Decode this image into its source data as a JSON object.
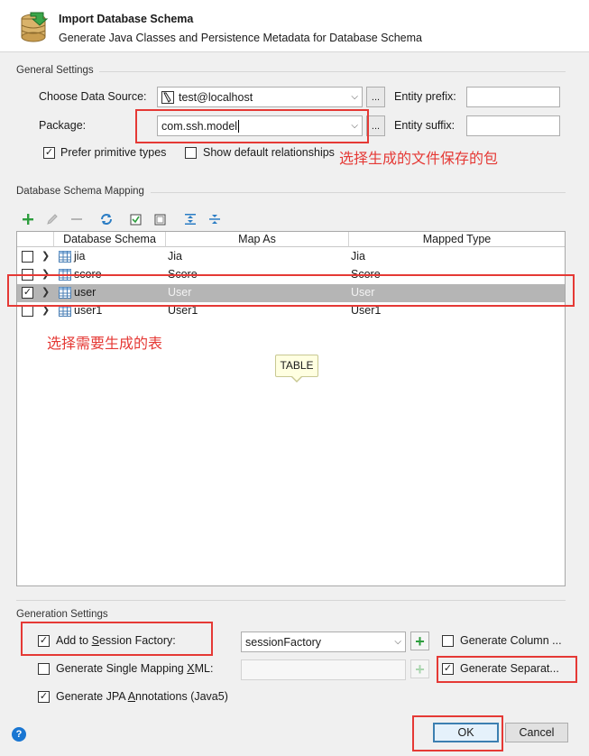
{
  "header": {
    "title": "Import Database Schema",
    "subtitle": "Generate Java Classes and Persistence Metadata for Database Schema"
  },
  "general": {
    "section_title": "General Settings",
    "datasource_label": "Choose Data Source:",
    "datasource_value": "test@localhost",
    "package_label": "Package:",
    "package_value": "com.ssh.model",
    "entity_prefix_label": "Entity prefix:",
    "entity_prefix_value": "",
    "entity_suffix_label": "Entity suffix:",
    "entity_suffix_value": "",
    "prefer_primitive_label": "Prefer primitive types",
    "prefer_primitive_checked": true,
    "show_relationships_label": "Show default relationships",
    "show_relationships_checked": false,
    "browse_label": "..."
  },
  "annotations": {
    "package_note": "选择生成的文件保存的包",
    "table_note": "选择需要生成的表"
  },
  "mapping": {
    "section_title": "Database Schema Mapping",
    "columns": [
      "Database Schema",
      "Map As",
      "Mapped Type"
    ],
    "rows": [
      {
        "checked": false,
        "schema": "jia",
        "map_as": "Jia",
        "mapped_type": "Jia",
        "selected": false
      },
      {
        "checked": false,
        "schema": "score",
        "map_as": "Score",
        "mapped_type": "Score",
        "selected": false
      },
      {
        "checked": true,
        "schema": "user",
        "map_as": "User",
        "mapped_type": "User",
        "selected": true
      },
      {
        "checked": false,
        "schema": "user1",
        "map_as": "User1",
        "mapped_type": "User1",
        "selected": false
      }
    ],
    "tooltip": "TABLE"
  },
  "generation": {
    "section_title": "Generation Settings",
    "add_session_factory_label": "Add to Session Factory:",
    "add_session_factory_checked": true,
    "session_factory_value": "sessionFactory",
    "generate_column_label": "Generate Column ...",
    "generate_column_checked": false,
    "single_mapping_label": "Generate Single Mapping XML:",
    "single_mapping_checked": false,
    "generate_separate_label": "Generate Separat...",
    "generate_separate_checked": true,
    "jpa_annotations_label": "Generate JPA Annotations (Java5)",
    "jpa_annotations_checked": true
  },
  "footer": {
    "ok_label": "OK",
    "cancel_label": "Cancel",
    "help_label": "?"
  },
  "colors": {
    "annotation_red": "#e53935",
    "green_plus": "#2e9e3e",
    "ok_border": "#3c7fb1"
  }
}
